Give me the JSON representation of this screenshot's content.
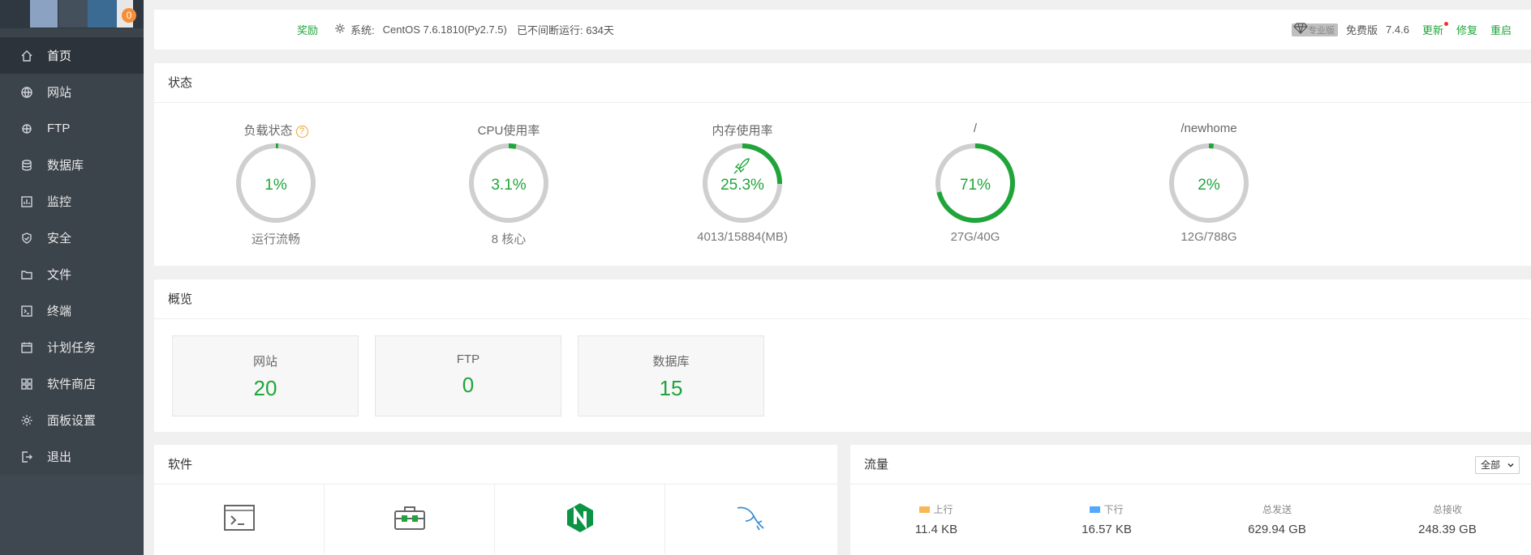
{
  "sidebar": {
    "badge": "0",
    "items": [
      {
        "label": "首页",
        "icon": "home-icon",
        "active": true
      },
      {
        "label": "网站",
        "icon": "globe-icon"
      },
      {
        "label": "FTP",
        "icon": "ftp-icon"
      },
      {
        "label": "数据库",
        "icon": "database-icon"
      },
      {
        "label": "监控",
        "icon": "monitor-icon"
      },
      {
        "label": "安全",
        "icon": "shield-icon"
      },
      {
        "label": "文件",
        "icon": "folder-icon"
      },
      {
        "label": "终端",
        "icon": "terminal-icon"
      },
      {
        "label": "计划任务",
        "icon": "calendar-icon"
      },
      {
        "label": "软件商店",
        "icon": "grid-icon"
      },
      {
        "label": "面板设置",
        "icon": "gear-icon"
      },
      {
        "label": "退出",
        "icon": "logout-icon"
      }
    ]
  },
  "topbar": {
    "reward": "奖励",
    "system_label": "系统:",
    "system_value": "CentOS 7.6.1810(Py2.7.5)",
    "uptime": "已不间断运行: 634天",
    "pro_tag": "专业版",
    "edition": "免费版",
    "version": "7.4.6",
    "update": "更新",
    "repair": "修复",
    "restart": "重启"
  },
  "status": {
    "title": "状态",
    "gauges": [
      {
        "title": "负载状态",
        "value": "1%",
        "sub": "运行流畅",
        "percent": 1,
        "help": "?"
      },
      {
        "title": "CPU使用率",
        "value": "3.1%",
        "sub": "8 核心",
        "percent": 3.1
      },
      {
        "title": "内存使用率",
        "value": "25.3%",
        "sub": "4013/15884(MB)",
        "percent": 25.3
      },
      {
        "title": "/",
        "value": "71%",
        "sub": "27G/40G",
        "percent": 71
      },
      {
        "title": "/newhome",
        "value": "2%",
        "sub": "12G/788G",
        "percent": 2
      }
    ]
  },
  "overview": {
    "title": "概览",
    "cards": [
      {
        "label": "网站",
        "value": "20"
      },
      {
        "label": "FTP",
        "value": "0"
      },
      {
        "label": "数据库",
        "value": "15"
      }
    ]
  },
  "software": {
    "title": "软件",
    "items": [
      "terminal-icon",
      "toolbox-icon",
      "nginx-icon",
      "mysql-icon"
    ]
  },
  "traffic": {
    "title": "流量",
    "select": "全部",
    "items": [
      {
        "label": "上行",
        "value": "11.4 KB",
        "color": "#f7b851"
      },
      {
        "label": "下行",
        "value": "16.57 KB",
        "color": "#52a9ff"
      },
      {
        "label": "总发送",
        "value": "629.94 GB"
      },
      {
        "label": "总接收",
        "value": "248.39 GB"
      }
    ]
  },
  "colors": {
    "accent": "#20a53a",
    "sidebar": "#3b434b",
    "warn": "#f0a02a"
  }
}
